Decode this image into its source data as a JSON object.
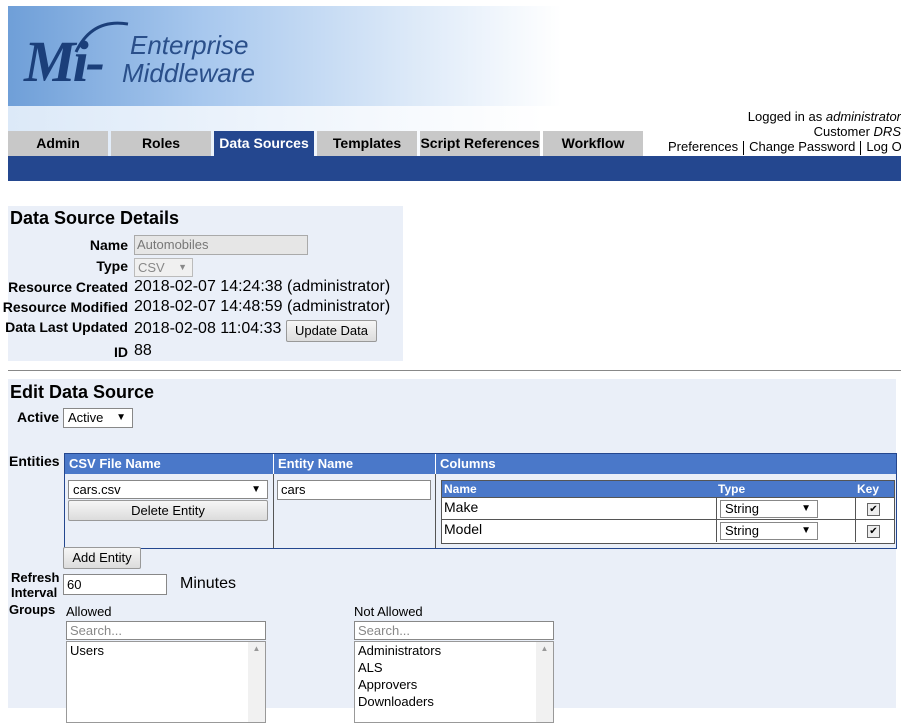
{
  "header": {
    "logo_mi": "Mi-",
    "logo_line1": "Enterprise",
    "logo_line2": "Middleware"
  },
  "user": {
    "logged_in_prefix": "Logged in as ",
    "username": "administrator",
    "customer_prefix": "Customer ",
    "customer": "DRS",
    "links": [
      "Preferences",
      "Change Password",
      "Log Out"
    ]
  },
  "tabs": [
    {
      "label": "Admin",
      "active": false
    },
    {
      "label": "Roles",
      "active": false
    },
    {
      "label": "Data Sources",
      "active": true
    },
    {
      "label": "Templates",
      "active": false
    },
    {
      "label": "Script References",
      "active": false
    },
    {
      "label": "Workflow",
      "active": false
    }
  ],
  "details": {
    "title": "Data Source Details",
    "name_label": "Name",
    "name_value": "Automobiles",
    "type_label": "Type",
    "type_value": "CSV",
    "created_label": "Resource Created",
    "created_value": "2018-02-07 14:24:38 (administrator)",
    "modified_label": "Resource Modified",
    "modified_value": "2018-02-07 14:48:59 (administrator)",
    "updated_label": "Data Last Updated",
    "updated_value": "2018-02-08 11:04:33",
    "update_button": "Update Data",
    "id_label": "ID",
    "id_value": "88"
  },
  "edit": {
    "title": "Edit Data Source",
    "active_label": "Active",
    "active_value": "Active",
    "entities_label": "Entities",
    "entity_headers": {
      "csv_file": "CSV File Name",
      "entity_name": "Entity Name",
      "columns": "Columns"
    },
    "entity": {
      "csv_file": "cars.csv",
      "delete_button": "Delete Entity",
      "entity_name": "cars"
    },
    "column_headers": {
      "name": "Name",
      "type": "Type",
      "key": "Key"
    },
    "columns": [
      {
        "name": "Make",
        "type": "String",
        "key": true
      },
      {
        "name": "Model",
        "type": "String",
        "key": true
      }
    ],
    "add_entity_button": "Add Entity",
    "refresh_label_1": "Refresh",
    "refresh_label_2": "Interval",
    "refresh_value": "60",
    "refresh_unit": "Minutes",
    "groups_label": "Groups",
    "allowed_label": "Allowed",
    "allowed_search_placeholder": "Search...",
    "allowed_items": [
      "Users"
    ],
    "not_allowed_label": "Not Allowed",
    "not_allowed_search_placeholder": "Search...",
    "not_allowed_items": [
      "Administrators",
      "ALS",
      "Approvers",
      "Downloaders"
    ]
  },
  "colors": {
    "nav_blue": "#24478f",
    "header_blue": "#4a78c9",
    "panel_bg": "#eaeff8",
    "tab_gray": "#c8c8c8"
  }
}
